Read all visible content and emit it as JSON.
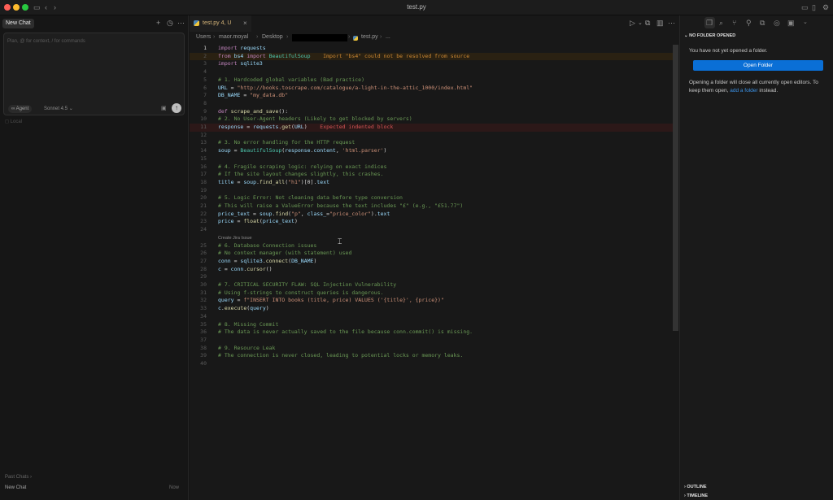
{
  "window": {
    "title": "test.py"
  },
  "left_panel": {
    "tab_label": "New Chat",
    "chat_placeholder": "Plan, @ for context, / for commands",
    "agent_label": "Agent",
    "model_label": "Sonnet 4.5",
    "local_label": "Local",
    "past_chats_label": "Past Chats",
    "history": [
      {
        "title": "New Chat",
        "time": "Now"
      }
    ]
  },
  "editor": {
    "tab": {
      "label": "test.py 4, U"
    },
    "breadcrumb": {
      "parts": [
        "Users",
        "maor.moyal",
        "Desktop",
        "test.py",
        "..."
      ]
    },
    "codelens": "Create Jira Issue",
    "lines": [
      {
        "n": "1",
        "t": "import requests"
      },
      {
        "n": "2",
        "t": "from bs4 import BeautifulSoup",
        "d": "Import \"bs4\" could not be resolved from source"
      },
      {
        "n": "3",
        "t": "import sqlite3"
      },
      {
        "n": "4",
        "t": ""
      },
      {
        "n": "5",
        "t": "# 1. Hardcoded global variables (Bad practice)"
      },
      {
        "n": "6",
        "t": "URL = \"http://books.toscrape.com/catalogue/a-light-in-the-attic_1000/index.html\""
      },
      {
        "n": "7",
        "t": "DB_NAME = \"my_data.db\""
      },
      {
        "n": "8",
        "t": ""
      },
      {
        "n": "9",
        "t": "def scrape_and_save():"
      },
      {
        "n": "10",
        "t": "# 2. No User-Agent headers (Likely to get blocked by servers)"
      },
      {
        "n": "11",
        "t": "response = requests.get(URL)",
        "d": "Expected indented block"
      },
      {
        "n": "12",
        "t": ""
      },
      {
        "n": "13",
        "t": "# 3. No error handling for the HTTP request"
      },
      {
        "n": "14",
        "t": "soup = BeautifulSoup(response.content, 'html.parser')"
      },
      {
        "n": "15",
        "t": ""
      },
      {
        "n": "16",
        "t": "# 4. Fragile scraping logic: relying on exact indices"
      },
      {
        "n": "17",
        "t": "# If the site layout changes slightly, this crashes."
      },
      {
        "n": "18",
        "t": "title = soup.find_all(\"h1\")[0].text"
      },
      {
        "n": "19",
        "t": ""
      },
      {
        "n": "20",
        "t": "# 5. Logic Error: Not cleaning data before type conversion"
      },
      {
        "n": "21",
        "t": "# This will raise a ValueError because the text includes \"£\" (e.g., \"£51.77\")"
      },
      {
        "n": "22",
        "t": "price_text = soup.find(\"p\", class_=\"price_color\").text"
      },
      {
        "n": "23",
        "t": "price = float(price_text)"
      },
      {
        "n": "24",
        "t": ""
      },
      {
        "n": "25",
        "t": "# 6. Database Connection issues"
      },
      {
        "n": "26",
        "t": "# No context manager (with statement) used"
      },
      {
        "n": "27",
        "t": "conn = sqlite3.connect(DB_NAME)"
      },
      {
        "n": "28",
        "t": "c = conn.cursor()"
      },
      {
        "n": "29",
        "t": ""
      },
      {
        "n": "30",
        "t": "# 7. CRITICAL SECURITY FLAW: SQL Injection Vulnerability"
      },
      {
        "n": "31",
        "t": "# Using f-strings to construct queries is dangerous."
      },
      {
        "n": "32",
        "t": "query = f\"INSERT INTO books (title, price) VALUES ('{title}', {price})\""
      },
      {
        "n": "33",
        "t": "c.execute(query)"
      },
      {
        "n": "34",
        "t": ""
      },
      {
        "n": "35",
        "t": "# 8. Missing Commit"
      },
      {
        "n": "36",
        "t": "# The data is never actually saved to the file because conn.commit() is missing."
      },
      {
        "n": "37",
        "t": ""
      },
      {
        "n": "38",
        "t": "# 9. Resource Leak"
      },
      {
        "n": "39",
        "t": "# The connection is never closed, leading to potential locks or memory leaks."
      },
      {
        "n": "40",
        "t": ""
      }
    ]
  },
  "right_panel": {
    "section_title": "NO FOLDER OPENED",
    "message": "You have not yet opened a folder.",
    "open_button": "Open Folder",
    "para_before": "Opening a folder will close all currently open editors. To keep them open, ",
    "para_link": "add a folder",
    "para_after": " instead.",
    "outline": "OUTLINE",
    "timeline": "TIMELINE"
  },
  "colors": {
    "accent": "#0a6fd6",
    "warning": "#cc8833",
    "error": "#d45454"
  }
}
